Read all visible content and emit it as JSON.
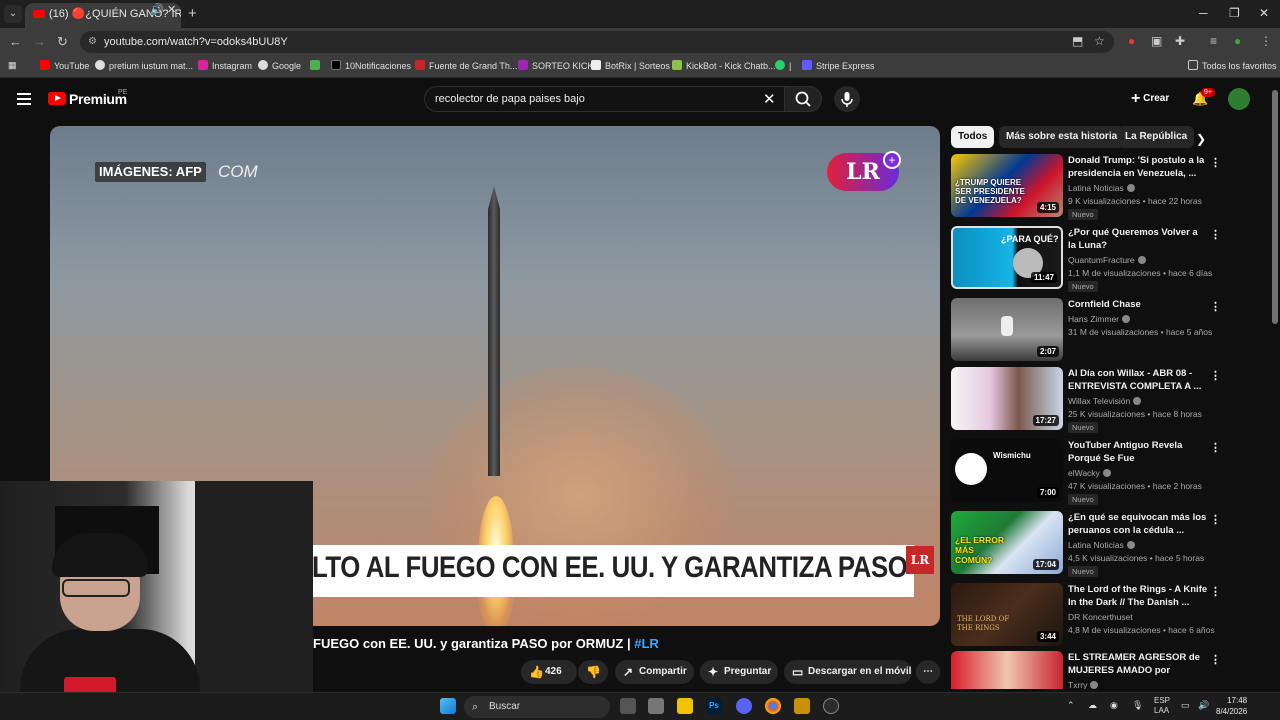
{
  "browser": {
    "tab_title": "(16) 🔴¿QUIÉN GANÓ? IR/",
    "url": "youtube.com/watch?v=odoks4bUU8Y",
    "bookmarks": [
      "YouTube",
      "pretium iustum mat...",
      "Instagram",
      "Google",
      "",
      "10Notificaciones",
      "Fuente de Grand Th...",
      "SORTEO KICK",
      "BotRix | Sorteos",
      "KickBot - Kick Chatb...",
      "|",
      "Stripe Express"
    ],
    "all_bookmarks": "Todos los favoritos"
  },
  "youtube": {
    "brand": "Premium",
    "region": "PE",
    "search_value": "recolector de papa paises bajo",
    "create_label": "Crear",
    "notif_count": "9+"
  },
  "video": {
    "overlay_credit": "IMÁGENES: AFP",
    "overlay_credit_suffix": "COM",
    "logo_text": "LR",
    "banner_text": "LTO AL FUEGO CON EE. UU. Y GARANTIZA PASO EN ORMUZ",
    "banner_logo": "LR",
    "title_text": "FUEGO con EE. UU. y garantiza PASO por ORMUZ | ",
    "title_tag": "#LR",
    "likes": "426",
    "share_label": "Compartir",
    "ask_label": "Preguntar",
    "download_label": "Descargar en el móvil"
  },
  "sidebar": {
    "chips": [
      "Todos",
      "Más sobre esta historia",
      "La República"
    ],
    "recommendations": [
      {
        "title": "Donald Trump: 'Si postulo a la presidencia en Venezuela, ...",
        "channel": "Latina Noticias",
        "meta": "9 K visualizaciones • hace 22 horas",
        "duration": "4:15",
        "badge": "Nuevo",
        "thumb_text": "¿TRUMP QUIERE SER PRESIDENTE DE VENEZUELA?"
      },
      {
        "title": "¿Por qué Queremos Volver a la Luna?",
        "channel": "QuantumFracture",
        "meta": "1,1 M de visualizaciones • hace 6 días",
        "duration": "11:47",
        "badge": "Nuevo",
        "thumb_text": "¿PARA QUÉ?"
      },
      {
        "title": "Cornfield Chase",
        "channel": "Hans Zimmer",
        "meta": "31 M de visualizaciones • hace 5 años",
        "duration": "2:07",
        "badge": "",
        "thumb_text": ""
      },
      {
        "title": "Al Día con Willax - ABR 08 - ENTREVISTA COMPLETA A ...",
        "channel": "Willax Televisión",
        "meta": "25 K visualizaciones • hace 8 horas",
        "duration": "17:27",
        "badge": "Nuevo",
        "thumb_text": ""
      },
      {
        "title": "YouTuber Antiguo Revela Porqué Se Fue",
        "channel": "elWacky",
        "meta": "47 K visualizaciones • hace 2 horas",
        "duration": "7:00",
        "badge": "Nuevo",
        "thumb_text": "Wismichu"
      },
      {
        "title": "¿En qué se equivocan más los peruanos con la cédula ...",
        "channel": "Latina Noticias",
        "meta": "4,5 K visualizaciones • hace 5 horas",
        "duration": "17:04",
        "badge": "Nuevo",
        "thumb_text": "¿EL ERROR MÁS COMÚN?"
      },
      {
        "title": "The Lord of the Rings - A Knife In the Dark // The Danish ...",
        "channel": "DR Koncerthuset",
        "meta": "4,8 M de visualizaciones • hace 6 años",
        "duration": "3:44",
        "badge": "",
        "thumb_text": "THE LORD OF THE RINGS"
      },
      {
        "title": "EL STREAMER AGRESOR de MUJERES AMADO por TIKTOK...",
        "channel": "Txrry",
        "meta": "",
        "duration": "",
        "badge": "",
        "thumb_text": ""
      }
    ]
  },
  "taskbar": {
    "search_label": "Buscar",
    "lang": "ESP",
    "lang2": "LAA",
    "time": "17:48",
    "date": "8/4/2026"
  },
  "colors": {
    "accent": "#ff0000",
    "link": "#3ea6ff",
    "bg": "#0f0f0f"
  }
}
